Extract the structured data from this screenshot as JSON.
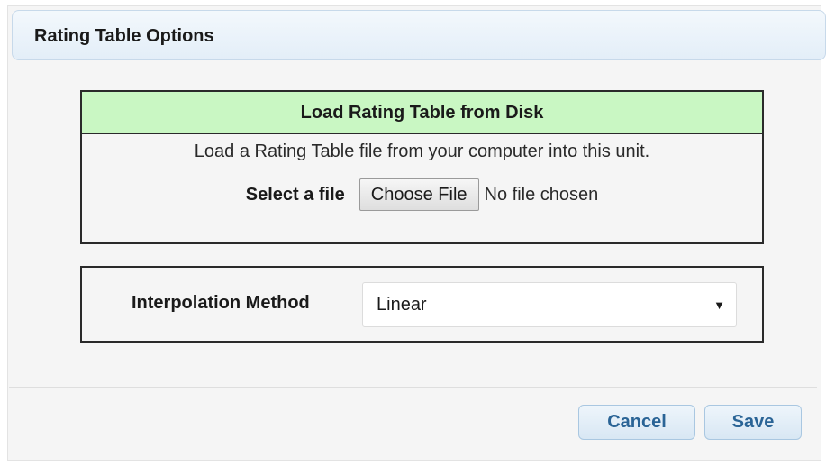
{
  "dialog": {
    "title": "Rating Table Options"
  },
  "load_panel": {
    "heading": "Load Rating Table from Disk",
    "description": "Load a Rating Table file from your computer into this unit.",
    "file_label": "Select a file",
    "choose_button": "Choose File",
    "file_status": "No file chosen",
    "heading_color": "#c9f7c3"
  },
  "interpolation": {
    "label": "Interpolation Method",
    "selected": "Linear",
    "arrow_glyph": "▼"
  },
  "footer": {
    "cancel_label": "Cancel",
    "save_label": "Save",
    "button_text_color": "#2a6496"
  }
}
